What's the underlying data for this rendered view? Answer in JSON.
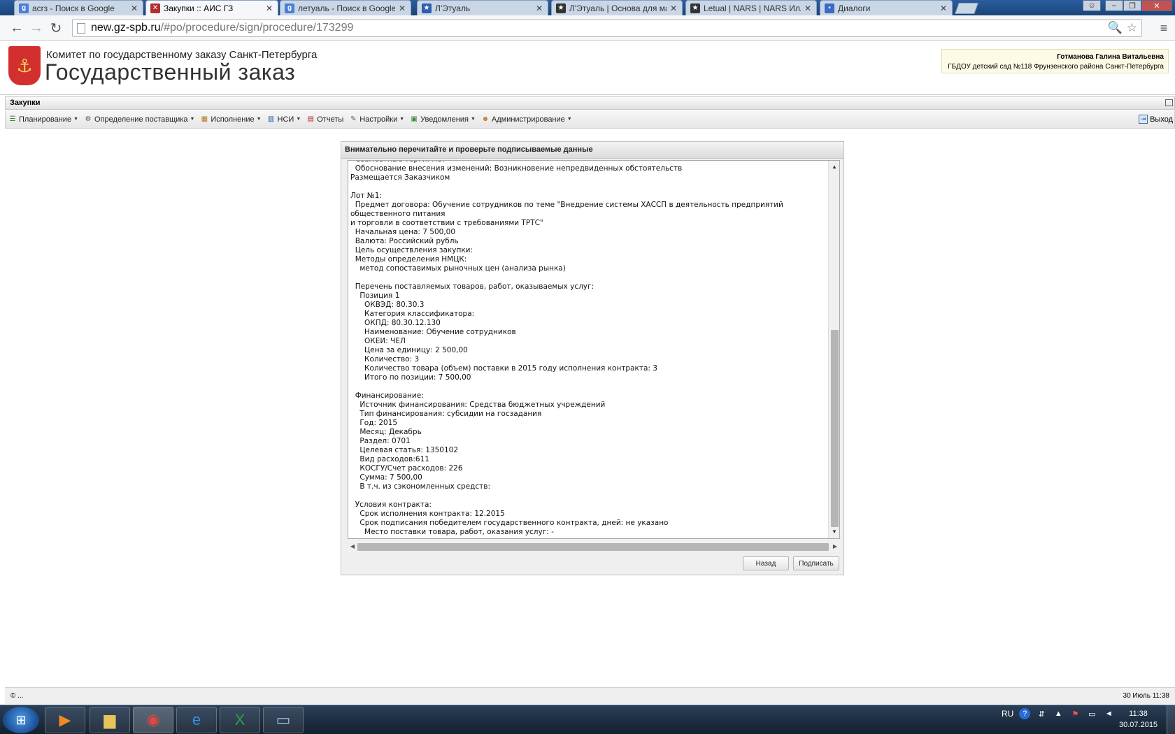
{
  "browser": {
    "tabs": [
      {
        "label": "acrз - Поиск в Google",
        "favicon": "google-icon",
        "color": "#4a7fd6"
      },
      {
        "label": "Закупки :: АИС ГЗ",
        "favicon": "tools-icon",
        "color": "#b03030"
      },
      {
        "label": "летуаль - Поиск в Google",
        "favicon": "google-icon",
        "color": "#4a7fd6"
      },
      {
        "label": "Л'Этуаль",
        "favicon": "star-icon",
        "color": "#2a5fb0"
      },
      {
        "label": "Л'Этуаль | Основа для ма",
        "favicon": "star-icon",
        "color": "#333333"
      },
      {
        "label": "Letual | NARS | NARS Илл",
        "favicon": "star-icon",
        "color": "#333333"
      },
      {
        "label": "Диалоги",
        "favicon": "chat-icon",
        "color": "#3a6cc4"
      }
    ],
    "active_tab": 1,
    "url_host": "new.gz-spb.ru",
    "url_path": "/#po/procedure/sign/procedure/173299"
  },
  "header": {
    "org_name": "Комитет по государственному заказу Санкт-Петербурга",
    "site_title": "Государственный заказ",
    "user_name": "Готманова Галина Витальевна",
    "user_org": "ГБДОУ детский сад №118 Фрунзенского района Санкт-Петербурга"
  },
  "panel": {
    "title": "Закупки"
  },
  "menu": {
    "items": [
      {
        "label": "Планирование",
        "icon": "plan-icon",
        "dropdown": true
      },
      {
        "label": "Определение поставщика",
        "icon": "gears-icon",
        "dropdown": true
      },
      {
        "label": "Исполнение",
        "icon": "execution-icon",
        "dropdown": true
      },
      {
        "label": "НСИ",
        "icon": "book-icon",
        "dropdown": true
      },
      {
        "label": "Отчеты",
        "icon": "report-icon",
        "dropdown": false
      },
      {
        "label": "Настройки",
        "icon": "wrench-icon",
        "dropdown": true
      },
      {
        "label": "Уведомления",
        "icon": "notification-icon",
        "dropdown": true
      },
      {
        "label": "Администрирование",
        "icon": "admin-icon",
        "dropdown": true
      }
    ],
    "logout_label": "Выход"
  },
  "dialog": {
    "title": "Внимательно перечитайте и проверьте подписываемые данные",
    "content": "  Совместные торги: Нет\n  Обоснование внесения изменений: Возникновение непредвиденных обстоятельств\nРазмещается Заказчиком\n\nЛот №1:\n  Предмет договора: Обучение сотрудников по теме \"Внедрение системы ХАССП в деятельность предприятий общественного питания\nи торговли в соответствии с требованиями ТРТС\"\n  Начальная цена: 7 500,00\n  Валюта: Российский рубль\n  Цель осуществления закупки:\n  Методы определения НМЦК:\n    метод сопоставимых рыночных цен (анализа рынка)\n\n  Перечень поставляемых товаров, работ, оказываемых услуг:\n    Позиция 1\n      ОКВЭД: 80.30.3\n      Категория классификатора:\n      ОКПД: 80.30.12.130\n      Наименование: Обучение сотрудников\n      ОКЕИ: ЧЕЛ\n      Цена за единицу: 2 500,00\n      Количество: 3\n      Количество товара (объем) поставки в 2015 году исполнения контракта: 3\n      Итого по позиции: 7 500,00\n\n  Финансирование:\n    Источник финансирования: Средства бюджетных учреждений\n    Тип финансирования: субсидии на госзадания\n    Год: 2015\n    Месяц: Декабрь\n    Раздел: 0701\n    Целевая статья: 1350102\n    Вид расходов:611\n    КОСГУ/Счет расходов: 226\n    Сумма: 7 500,00\n    В т.ч. из сэкономленных средств:\n\n  Условия контракта:\n    Срок исполнения контракта: 12.2015\n    Срок подписания победителем государственного контракта, дней: не указано\n      Место поставки товара, работ, оказания услуг: -",
    "back_label": "Назад",
    "sign_label": "Подписать"
  },
  "footer": {
    "copyright": "© ...",
    "datetime": "30 Июль 11:38"
  },
  "taskbar": {
    "language": "RU",
    "time": "11:38",
    "date": "30.07.2015"
  }
}
